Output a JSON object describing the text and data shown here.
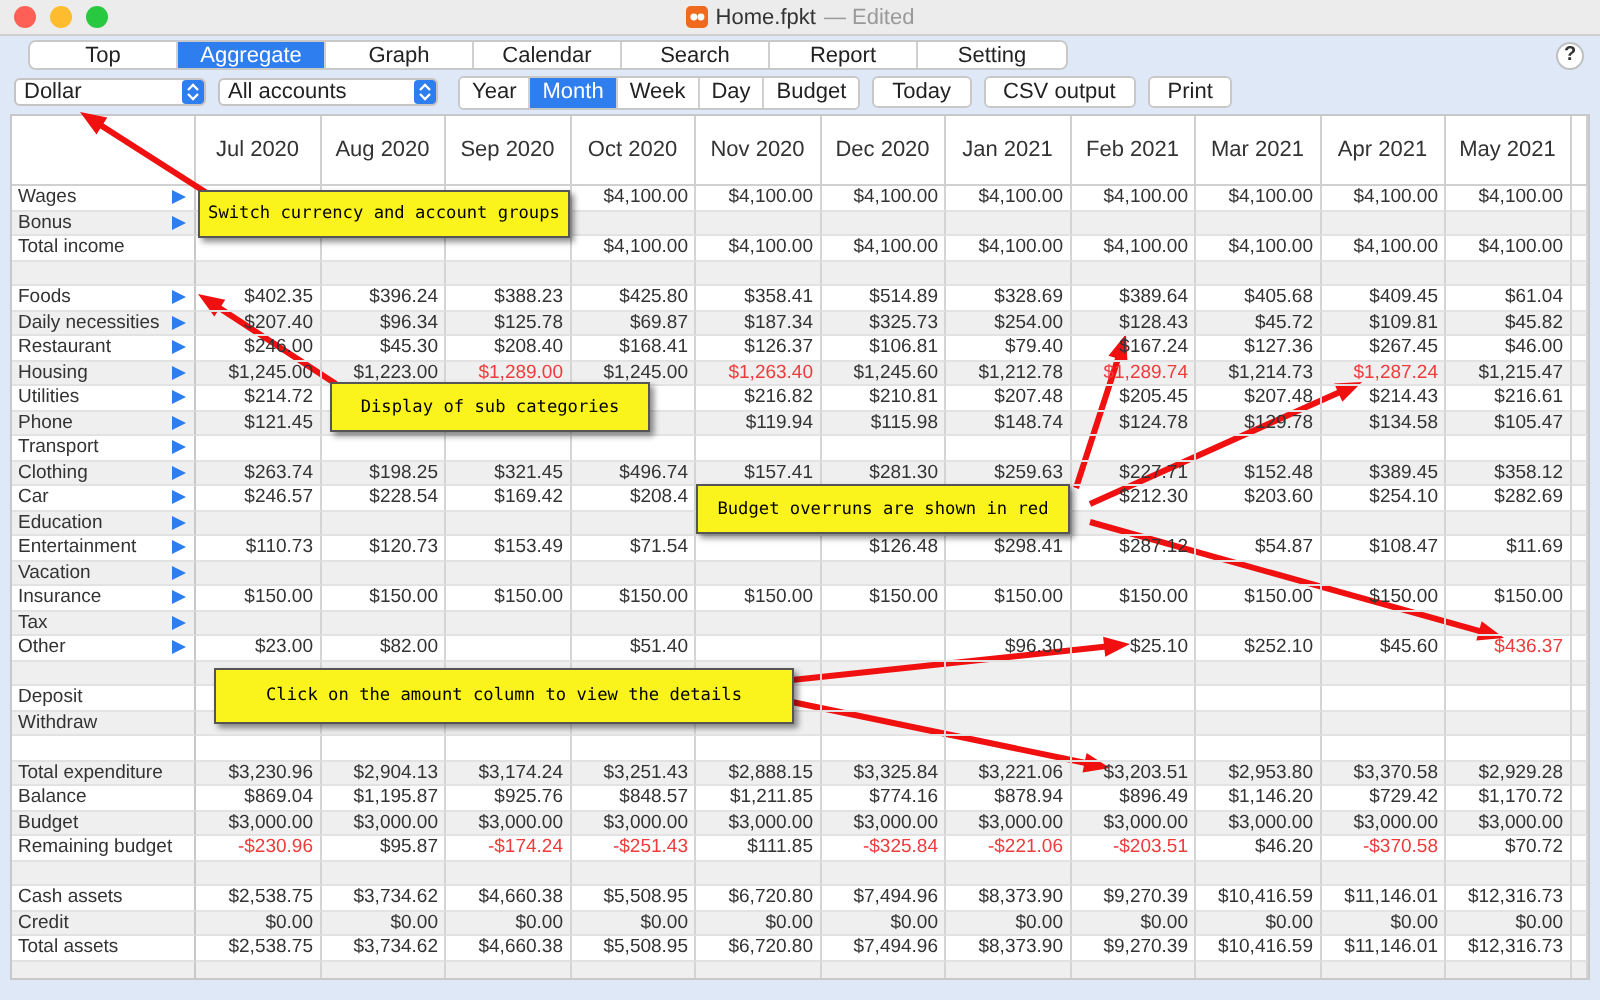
{
  "window": {
    "title": "Home.fpkt",
    "status": "— Edited"
  },
  "tabs": [
    {
      "label": "Top",
      "selected": false
    },
    {
      "label": "Aggregate",
      "selected": true
    },
    {
      "label": "Graph",
      "selected": false
    },
    {
      "label": "Calendar",
      "selected": false
    },
    {
      "label": "Search",
      "selected": false
    },
    {
      "label": "Report",
      "selected": false
    },
    {
      "label": "Setting",
      "selected": false
    }
  ],
  "help": "?",
  "currency": "Dollar",
  "accounts": "All accounts",
  "periods": [
    {
      "label": "Year",
      "selected": false
    },
    {
      "label": "Month",
      "selected": true
    },
    {
      "label": "Week",
      "selected": false
    },
    {
      "label": "Day",
      "selected": false
    },
    {
      "label": "Budget",
      "selected": false
    }
  ],
  "buttons": [
    "Today",
    "CSV output",
    "Print"
  ],
  "table": {
    "columns": [
      "Jul 2020",
      "Aug 2020",
      "Sep 2020",
      "Oct 2020",
      "Nov 2020",
      "Dec 2020",
      "Jan 2021",
      "Feb 2021",
      "Mar 2021",
      "Apr 2021",
      "May 2021"
    ],
    "rows": [
      {
        "label": "Wages",
        "expandable": true,
        "cells": [
          null,
          null,
          null,
          "$4,100.00",
          "$4,100.00",
          "$4,100.00",
          "$4,100.00",
          "$4,100.00",
          "$4,100.00",
          "$4,100.00",
          "$4,100.00"
        ]
      },
      {
        "label": "Bonus",
        "expandable": true
      },
      {
        "label": "Total income",
        "expandable": false,
        "cells": [
          null,
          null,
          null,
          "$4,100.00",
          "$4,100.00",
          "$4,100.00",
          "$4,100.00",
          "$4,100.00",
          "$4,100.00",
          "$4,100.00",
          "$4,100.00"
        ]
      },
      null,
      {
        "label": "Foods",
        "expandable": true,
        "cells": [
          "$402.35",
          "$396.24",
          "$388.23",
          "$425.80",
          "$358.41",
          "$514.89",
          "$328.69",
          "$389.64",
          "$405.68",
          "$409.45",
          "$61.04"
        ]
      },
      {
        "label": "Daily necessities",
        "expandable": true,
        "cells": [
          "$207.40",
          "$96.34",
          "$125.78",
          "$69.87",
          "$187.34",
          "$325.73",
          "$254.00",
          "$128.43",
          "$45.72",
          "$109.81",
          "$45.82"
        ]
      },
      {
        "label": "Restaurant",
        "expandable": true,
        "cells": [
          "$246.00",
          "$45.30",
          "$208.40",
          "$168.41",
          "$126.37",
          "$106.81",
          "$79.40",
          "$167.24",
          "$127.36",
          "$267.45",
          "$46.00"
        ]
      },
      {
        "label": "Housing",
        "expandable": true,
        "cells": [
          {
            "text": "$1,245.00",
            "over_budget": false
          },
          {
            "text": "$1,223.00",
            "over_budget": false
          },
          {
            "text": "$1,289.00",
            "over_budget": true
          },
          {
            "text": "$1,245.00",
            "over_budget": false
          },
          {
            "text": "$1,263.40",
            "over_budget": true
          },
          {
            "text": "$1,245.60",
            "over_budget": false
          },
          {
            "text": "$1,212.78",
            "over_budget": false
          },
          {
            "text": "$1,289.74",
            "over_budget": true
          },
          {
            "text": "$1,214.73",
            "over_budget": false
          },
          {
            "text": "$1,287.24",
            "over_budget": true
          },
          {
            "text": "$1,215.47",
            "over_budget": false
          }
        ]
      },
      {
        "label": "Utilities",
        "expandable": true,
        "cells": [
          "$214.72",
          null,
          null,
          null,
          "$216.82",
          "$210.81",
          "$207.48",
          "$205.45",
          "$207.48",
          "$214.43",
          "$216.61"
        ]
      },
      {
        "label": "Phone",
        "expandable": true,
        "cells": [
          "$121.45",
          null,
          null,
          null,
          "$119.94",
          "$115.98",
          "$148.74",
          "$124.78",
          "$129.78",
          "$134.58",
          "$105.47"
        ]
      },
      {
        "label": "Transport",
        "expandable": true
      },
      {
        "label": "Clothing",
        "expandable": true,
        "cells": [
          "$263.74",
          "$198.25",
          "$321.45",
          "$496.74",
          "$157.41",
          "$281.30",
          "$259.63",
          "$227.71",
          "$152.48",
          "$389.45",
          "$358.12"
        ]
      },
      {
        "label": "Car",
        "expandable": true,
        "cells": [
          "$246.57",
          "$228.54",
          "$169.42",
          "$208.4",
          null,
          null,
          null,
          "$212.30",
          "$203.60",
          "$254.10",
          "$282.69"
        ]
      },
      {
        "label": "Education",
        "expandable": true
      },
      {
        "label": "Entertainment",
        "expandable": true,
        "cells": [
          "$110.73",
          "$120.73",
          "$153.49",
          "$71.54",
          null,
          "$126.48",
          "$298.41",
          "$287.12",
          "$54.87",
          "$108.47",
          "$11.69"
        ]
      },
      {
        "label": "Vacation",
        "expandable": true
      },
      {
        "label": "Insurance",
        "expandable": true,
        "cells": [
          "$150.00",
          "$150.00",
          "$150.00",
          "$150.00",
          "$150.00",
          "$150.00",
          "$150.00",
          "$150.00",
          "$150.00",
          "$150.00",
          "$150.00"
        ]
      },
      {
        "label": "Tax",
        "expandable": true
      },
      {
        "label": "Other",
        "expandable": true,
        "cells": [
          {
            "text": "$23.00",
            "over_budget": false
          },
          {
            "text": "$82.00",
            "over_budget": false
          },
          null,
          {
            "text": "$51.40",
            "over_budget": false
          },
          null,
          null,
          {
            "text": "$96.30",
            "over_budget": false
          },
          {
            "text": "$25.10",
            "over_budget": false
          },
          {
            "text": "$252.10",
            "over_budget": false
          },
          {
            "text": "$45.60",
            "over_budget": false
          },
          {
            "text": "$436.37",
            "over_budget": true
          }
        ]
      },
      null,
      {
        "label": "Deposit",
        "expandable": false
      },
      {
        "label": "Withdraw",
        "expandable": false
      },
      null,
      {
        "label": "Total expenditure",
        "expandable": false,
        "cells": [
          "$3,230.96",
          "$2,904.13",
          "$3,174.24",
          "$3,251.43",
          "$2,888.15",
          "$3,325.84",
          "$3,221.06",
          "$3,203.51",
          "$2,953.80",
          "$3,370.58",
          "$2,929.28"
        ]
      },
      {
        "label": "Balance",
        "expandable": false,
        "cells": [
          "$869.04",
          "$1,195.87",
          "$925.76",
          "$848.57",
          "$1,211.85",
          "$774.16",
          "$878.94",
          "$896.49",
          "$1,146.20",
          "$729.42",
          "$1,170.72"
        ]
      },
      {
        "label": "Budget",
        "expandable": false,
        "cells": [
          "$3,000.00",
          "$3,000.00",
          "$3,000.00",
          "$3,000.00",
          "$3,000.00",
          "$3,000.00",
          "$3,000.00",
          "$3,000.00",
          "$3,000.00",
          "$3,000.00",
          "$3,000.00"
        ]
      },
      {
        "label": "Remaining budget",
        "expandable": false,
        "cells": [
          {
            "text": "-$230.96",
            "over_budget": true
          },
          {
            "text": "$95.87",
            "over_budget": false
          },
          {
            "text": "-$174.24",
            "over_budget": true
          },
          {
            "text": "-$251.43",
            "over_budget": true
          },
          {
            "text": "$111.85",
            "over_budget": false
          },
          {
            "text": "-$325.84",
            "over_budget": true
          },
          {
            "text": "-$221.06",
            "over_budget": true
          },
          {
            "text": "-$203.51",
            "over_budget": true
          },
          {
            "text": "$46.20",
            "over_budget": false
          },
          {
            "text": "-$370.58",
            "over_budget": true
          },
          {
            "text": "$70.72",
            "over_budget": false
          }
        ]
      },
      null,
      {
        "label": "Cash assets",
        "expandable": false,
        "cells": [
          "$2,538.75",
          "$3,734.62",
          "$4,660.38",
          "$5,508.95",
          "$6,720.80",
          "$7,494.96",
          "$8,373.90",
          "$9,270.39",
          "$10,416.59",
          "$11,146.01",
          "$12,316.73"
        ]
      },
      {
        "label": "Credit",
        "expandable": false,
        "cells": [
          "$0.00",
          "$0.00",
          "$0.00",
          "$0.00",
          "$0.00",
          "$0.00",
          "$0.00",
          "$0.00",
          "$0.00",
          "$0.00",
          "$0.00"
        ]
      },
      {
        "label": "Total assets",
        "expandable": false,
        "cells": [
          "$2,538.75",
          "$3,734.62",
          "$4,660.38",
          "$5,508.95",
          "$6,720.80",
          "$7,494.96",
          "$8,373.90",
          "$9,270.39",
          "$10,416.59",
          "$11,146.01",
          "$12,316.73"
        ]
      },
      null
    ]
  },
  "callouts": [
    "Switch currency and account groups",
    "Display of sub categories",
    "Budget overruns are shown in red",
    "Click on the amount column to view the details"
  ]
}
